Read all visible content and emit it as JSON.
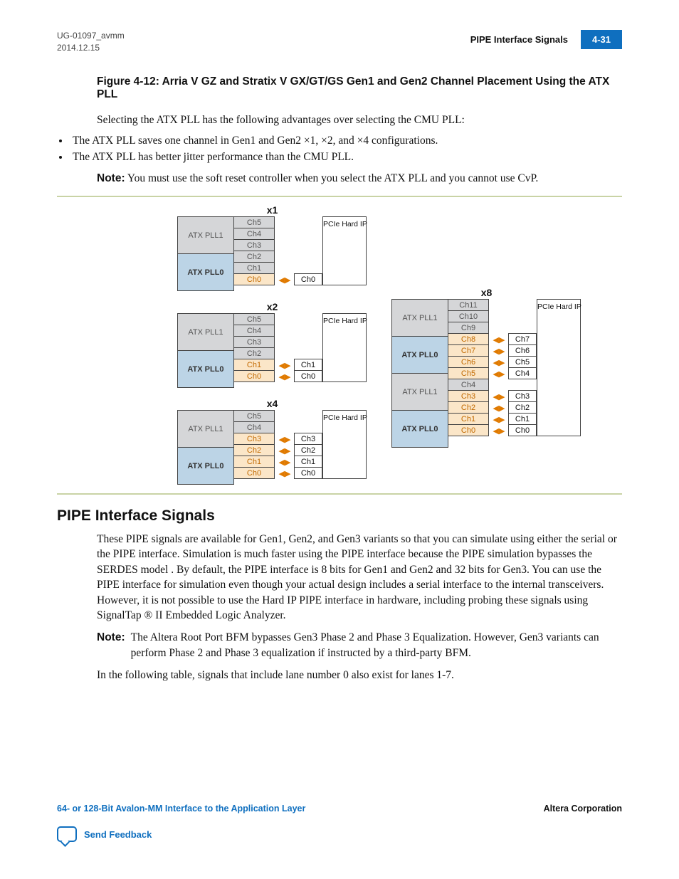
{
  "header": {
    "doc_id": "UG-01097_avmm",
    "date": "2014.12.15",
    "section": "PIPE Interface Signals",
    "page": "4-31"
  },
  "figure": {
    "caption": "Figure 4-12: Arria V GZ and Stratix V GX/GT/GS Gen1 and Gen2 Channel Placement Using the ATX PLL"
  },
  "intro": "Selecting the ATX PLL has the following advantages over selecting the CMU PLL:",
  "bullets": [
    "The ATX PLL saves one channel in Gen1 and Gen2 ×1, ×2, and ×4 configurations.",
    "The ATX PLL has better jitter performance than the CMU PLL."
  ],
  "note1_label": "Note:",
  "note1": "You must use the soft reset controller when you select the ATX PLL and you cannot use CvP.",
  "diagrams": {
    "hip": "PCIe Hard IP",
    "arrow_glyph": "◀▶",
    "x1": {
      "title": "x1",
      "plls": [
        "ATX PLL1",
        "ATX PLL0"
      ],
      "mids": [
        "Ch5",
        "Ch4",
        "Ch3",
        "Ch2",
        "Ch1",
        "Ch0"
      ],
      "active_m": [
        false,
        false,
        false,
        false,
        false,
        true
      ],
      "rch": [
        null,
        null,
        null,
        null,
        null,
        "Ch0"
      ]
    },
    "x2": {
      "title": "x2",
      "plls": [
        "ATX PLL1",
        "ATX PLL0"
      ],
      "mids": [
        "Ch5",
        "Ch4",
        "Ch3",
        "Ch2",
        "Ch1",
        "Ch0"
      ],
      "active_m": [
        false,
        false,
        false,
        false,
        true,
        true
      ],
      "rch": [
        null,
        null,
        null,
        null,
        "Ch1",
        "Ch0"
      ]
    },
    "x4": {
      "title": "x4",
      "plls": [
        "ATX PLL1",
        "ATX PLL0"
      ],
      "mids": [
        "Ch5",
        "Ch4",
        "Ch3",
        "Ch2",
        "Ch1",
        "Ch0"
      ],
      "active_m": [
        false,
        false,
        true,
        true,
        true,
        true
      ],
      "rch": [
        null,
        null,
        "Ch3",
        "Ch2",
        "Ch1",
        "Ch0"
      ]
    },
    "x8": {
      "title": "x8",
      "plls": [
        "ATX PLL1",
        "ATX PLL0",
        "ATX PLL1",
        "ATX PLL0"
      ],
      "pll_active": [
        false,
        true,
        false,
        true
      ],
      "mids": [
        "Ch11",
        "Ch10",
        "Ch9",
        "Ch8",
        "Ch7",
        "Ch6",
        "Ch5",
        "Ch4",
        "Ch3",
        "Ch2",
        "Ch1",
        "Ch0"
      ],
      "active_m": [
        false,
        false,
        false,
        true,
        true,
        true,
        true,
        false,
        true,
        true,
        true,
        true
      ],
      "rch": [
        null,
        null,
        null,
        "Ch7",
        "Ch6",
        "Ch5",
        "Ch4",
        null,
        "Ch3",
        "Ch2",
        "Ch1",
        "Ch0"
      ]
    }
  },
  "h2": "PIPE Interface Signals",
  "pipe_para": "These PIPE signals are available for Gen1, Gen2, and Gen3 variants so that you can simulate using either the serial or the PIPE interface. Simulation is much faster using the PIPE interface because the PIPE simulation bypasses the SERDES model . By default, the PIPE interface is 8 bits for Gen1 and Gen2 and 32 bits for Gen3. You can use the PIPE interface for simulation even though your actual design includes a serial interface to the internal transceivers. However, it is not possible to use the Hard IP PIPE interface in hardware, including probing these signals using SignalTap ® II Embedded Logic Analyzer.",
  "note2_label": "Note:",
  "note2": "The Altera Root Port BFM bypasses Gen3 Phase 2 and Phase 3 Equalization. However, Gen3 variants can perform Phase 2 and Phase 3 equalization if instructed by a third-party BFM.",
  "followup": "In the following table, signals that include lane number 0 also exist for lanes 1-7.",
  "footer": {
    "left": "64- or 128-Bit Avalon-MM Interface to the Application Layer",
    "right": "Altera Corporation",
    "feedback": "Send Feedback"
  }
}
